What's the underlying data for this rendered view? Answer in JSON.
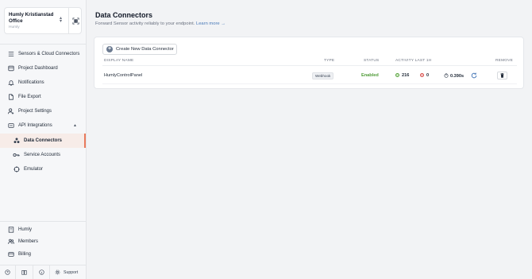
{
  "project": {
    "name": "Humly Kristianstad Office",
    "org": "Humly"
  },
  "nav": {
    "sensors": "Sensors & Cloud Connectors",
    "dashboard": "Project Dashboard",
    "notifications": "Notifications",
    "export": "File Export",
    "settings": "Project Settings",
    "api": "API Integrations",
    "connectors": "Data Connectors",
    "service_accounts": "Service Accounts",
    "emulator": "Emulator",
    "org_humly": "Humly",
    "members": "Members",
    "billing": "Billing",
    "support": "Support"
  },
  "page": {
    "title": "Data Connectors",
    "subtitle": "Forward Sensor activity reliably to your endpoint.",
    "learn_more": "Learn more →"
  },
  "create_button": "Create New Data Connector",
  "table": {
    "headers": {
      "display_name": "DISPLAY NAME",
      "type": "TYPE",
      "status": "STATUS",
      "activity": "ACTIVITY LAST 1H",
      "remove": "REMOVE"
    },
    "row": {
      "name": "HumlyControlPanel",
      "type": "Webhook",
      "status": "Enabled",
      "success": "216",
      "errors": "0",
      "latency": "0.390s"
    }
  },
  "colors": {
    "accent": "#e97a5c",
    "success": "#4f9b37",
    "link": "#4a7ab8"
  }
}
